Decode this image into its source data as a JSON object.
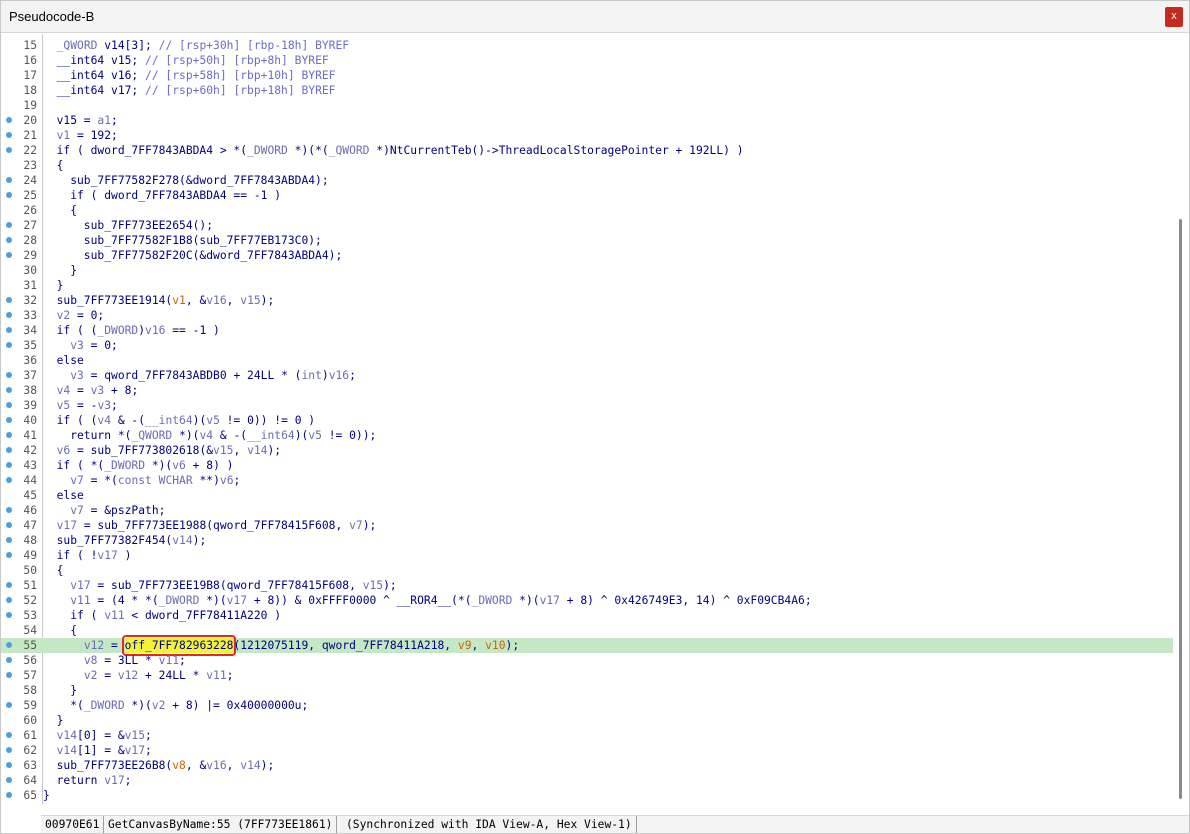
{
  "window": {
    "title": "Pseudocode-B",
    "close_label": "x"
  },
  "lines": [
    {
      "n": "15",
      "dot": false,
      "tokens": [
        [
          "v",
          "  "
        ],
        [
          "t",
          "_QWORD"
        ],
        [
          "v",
          " v14[3]; "
        ],
        [
          "cm",
          "// [rsp+30h] [rbp-18h] BYREF"
        ]
      ]
    },
    {
      "n": "16",
      "dot": false,
      "tokens": [
        [
          "v",
          "  __int64 v15; "
        ],
        [
          "cm",
          "// [rsp+50h] [rbp+8h] BYREF"
        ]
      ]
    },
    {
      "n": "17",
      "dot": false,
      "tokens": [
        [
          "v",
          "  __int64 v16; "
        ],
        [
          "cm",
          "// [rsp+58h] [rbp+10h] BYREF"
        ]
      ]
    },
    {
      "n": "18",
      "dot": false,
      "tokens": [
        [
          "v",
          "  __int64 v17; "
        ],
        [
          "cm",
          "// [rsp+60h] [rbp+18h] BYREF"
        ]
      ]
    },
    {
      "n": "19",
      "dot": false,
      "tokens": []
    },
    {
      "n": "20",
      "dot": true,
      "tokens": [
        [
          "v",
          "  v15 = "
        ],
        [
          "g",
          "a1"
        ],
        [
          "v",
          ";"
        ]
      ]
    },
    {
      "n": "21",
      "dot": true,
      "tokens": [
        [
          "v",
          "  "
        ],
        [
          "g",
          "v1"
        ],
        [
          "v",
          " = 192;"
        ]
      ]
    },
    {
      "n": "22",
      "dot": true,
      "tokens": [
        [
          "v",
          "  if ( dword_7FF7843ABDA4 > *("
        ],
        [
          "g",
          "_DWORD"
        ],
        [
          "v",
          " *)(*("
        ],
        [
          "g",
          "_QWORD"
        ],
        [
          "v",
          " *)NtCurrentTeb()->ThreadLocalStoragePointer + 192LL) )"
        ]
      ]
    },
    {
      "n": "23",
      "dot": false,
      "tokens": [
        [
          "v",
          "  {"
        ]
      ]
    },
    {
      "n": "24",
      "dot": true,
      "tokens": [
        [
          "v",
          "    sub_7FF77582F278(&dword_7FF7843ABDA4);"
        ]
      ]
    },
    {
      "n": "25",
      "dot": true,
      "tokens": [
        [
          "v",
          "    if ( dword_7FF7843ABDA4 == -1 )"
        ]
      ]
    },
    {
      "n": "26",
      "dot": false,
      "tokens": [
        [
          "v",
          "    {"
        ]
      ]
    },
    {
      "n": "27",
      "dot": true,
      "tokens": [
        [
          "v",
          "      sub_7FF773EE2654();"
        ]
      ]
    },
    {
      "n": "28",
      "dot": true,
      "tokens": [
        [
          "v",
          "      sub_7FF77582F1B8(sub_7FF77EB173C0);"
        ]
      ]
    },
    {
      "n": "29",
      "dot": true,
      "tokens": [
        [
          "v",
          "      sub_7FF77582F20C(&dword_7FF7843ABDA4);"
        ]
      ]
    },
    {
      "n": "30",
      "dot": false,
      "tokens": [
        [
          "v",
          "    }"
        ]
      ]
    },
    {
      "n": "31",
      "dot": false,
      "tokens": [
        [
          "v",
          "  }"
        ]
      ]
    },
    {
      "n": "32",
      "dot": true,
      "tokens": [
        [
          "v",
          "  sub_7FF773EE1914("
        ],
        [
          "o",
          "v1"
        ],
        [
          "v",
          ", &"
        ],
        [
          "g",
          "v16"
        ],
        [
          "v",
          ", "
        ],
        [
          "g",
          "v15"
        ],
        [
          "v",
          ");"
        ]
      ]
    },
    {
      "n": "33",
      "dot": true,
      "tokens": [
        [
          "v",
          "  "
        ],
        [
          "g",
          "v2"
        ],
        [
          "v",
          " = 0;"
        ]
      ]
    },
    {
      "n": "34",
      "dot": true,
      "tokens": [
        [
          "v",
          "  if ( ("
        ],
        [
          "g",
          "_DWORD"
        ],
        [
          "v",
          ")"
        ],
        [
          "g",
          "v16"
        ],
        [
          "v",
          " == -1 )"
        ]
      ]
    },
    {
      "n": "35",
      "dot": true,
      "tokens": [
        [
          "v",
          "    "
        ],
        [
          "g",
          "v3"
        ],
        [
          "v",
          " = 0;"
        ]
      ]
    },
    {
      "n": "36",
      "dot": false,
      "tokens": [
        [
          "v",
          "  else"
        ]
      ]
    },
    {
      "n": "37",
      "dot": true,
      "tokens": [
        [
          "v",
          "    "
        ],
        [
          "g",
          "v3"
        ],
        [
          "v",
          " = qword_7FF7843ABDB0 + 24LL * ("
        ],
        [
          "g",
          "int"
        ],
        [
          "v",
          ")"
        ],
        [
          "g",
          "v16"
        ],
        [
          "v",
          ";"
        ]
      ]
    },
    {
      "n": "38",
      "dot": true,
      "tokens": [
        [
          "v",
          "  "
        ],
        [
          "g",
          "v4"
        ],
        [
          "v",
          " = "
        ],
        [
          "g",
          "v3"
        ],
        [
          "v",
          " + 8;"
        ]
      ]
    },
    {
      "n": "39",
      "dot": true,
      "tokens": [
        [
          "v",
          "  "
        ],
        [
          "g",
          "v5"
        ],
        [
          "v",
          " = -"
        ],
        [
          "g",
          "v3"
        ],
        [
          "v",
          ";"
        ]
      ]
    },
    {
      "n": "40",
      "dot": true,
      "tokens": [
        [
          "v",
          "  if ( ("
        ],
        [
          "g",
          "v4"
        ],
        [
          "v",
          " & -("
        ],
        [
          "g",
          "__int64"
        ],
        [
          "v",
          ")("
        ],
        [
          "g",
          "v5"
        ],
        [
          "v",
          " != 0)) != 0 )"
        ]
      ]
    },
    {
      "n": "41",
      "dot": true,
      "tokens": [
        [
          "v",
          "    return *("
        ],
        [
          "g",
          "_QWORD"
        ],
        [
          "v",
          " *)("
        ],
        [
          "g",
          "v4"
        ],
        [
          "v",
          " & -("
        ],
        [
          "g",
          "__int64"
        ],
        [
          "v",
          ")("
        ],
        [
          "g",
          "v5"
        ],
        [
          "v",
          " != 0));"
        ]
      ]
    },
    {
      "n": "42",
      "dot": true,
      "tokens": [
        [
          "v",
          "  "
        ],
        [
          "g",
          "v6"
        ],
        [
          "v",
          " = sub_7FF773802618(&"
        ],
        [
          "g",
          "v15"
        ],
        [
          "v",
          ", "
        ],
        [
          "g",
          "v14"
        ],
        [
          "v",
          ");"
        ]
      ]
    },
    {
      "n": "43",
      "dot": true,
      "tokens": [
        [
          "v",
          "  if ( *("
        ],
        [
          "g",
          "_DWORD"
        ],
        [
          "v",
          " *)("
        ],
        [
          "g",
          "v6"
        ],
        [
          "v",
          " + 8) )"
        ]
      ]
    },
    {
      "n": "44",
      "dot": true,
      "tokens": [
        [
          "v",
          "    "
        ],
        [
          "g",
          "v7"
        ],
        [
          "v",
          " = *("
        ],
        [
          "g",
          "const WCHAR"
        ],
        [
          "v",
          " **)"
        ],
        [
          "g",
          "v6"
        ],
        [
          "v",
          ";"
        ]
      ]
    },
    {
      "n": "45",
      "dot": false,
      "tokens": [
        [
          "v",
          "  else"
        ]
      ]
    },
    {
      "n": "46",
      "dot": true,
      "tokens": [
        [
          "v",
          "    "
        ],
        [
          "g",
          "v7"
        ],
        [
          "v",
          " = &pszPath;"
        ]
      ]
    },
    {
      "n": "47",
      "dot": true,
      "tokens": [
        [
          "v",
          "  "
        ],
        [
          "g",
          "v17"
        ],
        [
          "v",
          " = sub_7FF773EE1988(qword_7FF78415F608, "
        ],
        [
          "g",
          "v7"
        ],
        [
          "v",
          ");"
        ]
      ]
    },
    {
      "n": "48",
      "dot": true,
      "tokens": [
        [
          "v",
          "  sub_7FF77382F454("
        ],
        [
          "g",
          "v14"
        ],
        [
          "v",
          ");"
        ]
      ]
    },
    {
      "n": "49",
      "dot": true,
      "tokens": [
        [
          "v",
          "  if ( !"
        ],
        [
          "g",
          "v17"
        ],
        [
          "v",
          " )"
        ]
      ]
    },
    {
      "n": "50",
      "dot": false,
      "tokens": [
        [
          "v",
          "  {"
        ]
      ]
    },
    {
      "n": "51",
      "dot": true,
      "tokens": [
        [
          "v",
          "    "
        ],
        [
          "g",
          "v17"
        ],
        [
          "v",
          " = sub_7FF773EE19B8(qword_7FF78415F608, "
        ],
        [
          "g",
          "v15"
        ],
        [
          "v",
          ");"
        ]
      ]
    },
    {
      "n": "52",
      "dot": true,
      "tokens": [
        [
          "v",
          "    "
        ],
        [
          "g",
          "v11"
        ],
        [
          "v",
          " = (4 * *("
        ],
        [
          "g",
          "_DWORD"
        ],
        [
          "v",
          " *)("
        ],
        [
          "g",
          "v17"
        ],
        [
          "v",
          " + 8)) & 0xFFFF0000 ^ __ROR4__(*("
        ],
        [
          "g",
          "_DWORD"
        ],
        [
          "v",
          " *)("
        ],
        [
          "g",
          "v17"
        ],
        [
          "v",
          " + 8) ^ 0x426749E3, 14) ^ 0xF09CB4A6;"
        ]
      ]
    },
    {
      "n": "53",
      "dot": true,
      "tokens": [
        [
          "v",
          "    if ( "
        ],
        [
          "g",
          "v11"
        ],
        [
          "v",
          " < dword_7FF78411A220 )"
        ]
      ]
    },
    {
      "n": "54",
      "dot": false,
      "tokens": [
        [
          "v",
          "    {"
        ]
      ]
    },
    {
      "n": "55",
      "dot": true,
      "hl": true,
      "tokens": [
        [
          "v",
          "      "
        ],
        [
          "g",
          "v12"
        ],
        [
          "v",
          " = "
        ],
        [
          "sel",
          "off_7FF782963228"
        ],
        [
          "v",
          "(1212075119, qword_7FF78411A218, "
        ],
        [
          "o",
          "v9"
        ],
        [
          "v",
          ", "
        ],
        [
          "o",
          "v10"
        ],
        [
          "v",
          ");"
        ]
      ]
    },
    {
      "n": "56",
      "dot": true,
      "tokens": [
        [
          "v",
          "      "
        ],
        [
          "g",
          "v8"
        ],
        [
          "v",
          " = 3LL * "
        ],
        [
          "g",
          "v11"
        ],
        [
          "v",
          ";"
        ]
      ]
    },
    {
      "n": "57",
      "dot": true,
      "tokens": [
        [
          "v",
          "      "
        ],
        [
          "g",
          "v2"
        ],
        [
          "v",
          " = "
        ],
        [
          "g",
          "v12"
        ],
        [
          "v",
          " + 24LL * "
        ],
        [
          "g",
          "v11"
        ],
        [
          "v",
          ";"
        ]
      ]
    },
    {
      "n": "58",
      "dot": false,
      "tokens": [
        [
          "v",
          "    }"
        ]
      ]
    },
    {
      "n": "59",
      "dot": true,
      "tokens": [
        [
          "v",
          "    *("
        ],
        [
          "g",
          "_DWORD"
        ],
        [
          "v",
          " *)("
        ],
        [
          "g",
          "v2"
        ],
        [
          "v",
          " + 8) |= 0x40000000u;"
        ]
      ]
    },
    {
      "n": "60",
      "dot": false,
      "tokens": [
        [
          "v",
          "  }"
        ]
      ]
    },
    {
      "n": "61",
      "dot": true,
      "tokens": [
        [
          "v",
          "  "
        ],
        [
          "g",
          "v14"
        ],
        [
          "v",
          "[0] = &"
        ],
        [
          "g",
          "v15"
        ],
        [
          "v",
          ";"
        ]
      ]
    },
    {
      "n": "62",
      "dot": true,
      "tokens": [
        [
          "v",
          "  "
        ],
        [
          "g",
          "v14"
        ],
        [
          "v",
          "[1] = &"
        ],
        [
          "g",
          "v17"
        ],
        [
          "v",
          ";"
        ]
      ]
    },
    {
      "n": "63",
      "dot": true,
      "tokens": [
        [
          "v",
          "  sub_7FF773EE26B8("
        ],
        [
          "o",
          "v8"
        ],
        [
          "v",
          ", &"
        ],
        [
          "g",
          "v16"
        ],
        [
          "v",
          ", "
        ],
        [
          "g",
          "v14"
        ],
        [
          "v",
          ");"
        ]
      ]
    },
    {
      "n": "64",
      "dot": true,
      "tokens": [
        [
          "v",
          "  return "
        ],
        [
          "g",
          "v17"
        ],
        [
          "v",
          ";"
        ]
      ]
    },
    {
      "n": "65",
      "dot": true,
      "tokens": [
        [
          "v",
          "}"
        ]
      ]
    }
  ],
  "status": {
    "address": "00970E61",
    "location": "GetCanvasByName:55 (7FF773EE1861)",
    "sync": "(Synchronized with IDA View-A, Hex View-1)"
  }
}
